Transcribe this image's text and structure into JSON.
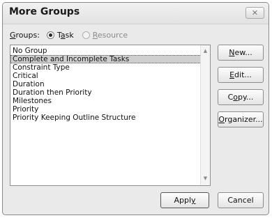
{
  "dialog": {
    "title": "More Groups",
    "close_glyph": "✕"
  },
  "groups": {
    "label_prefix": "G",
    "label_rest": "roups:",
    "options": [
      {
        "pre": "T",
        "u": "a",
        "post": "sk",
        "checked": true,
        "enabled": true
      },
      {
        "pre": "",
        "u": "R",
        "post": "esource",
        "checked": false,
        "enabled": false
      }
    ]
  },
  "list": {
    "items": [
      "No Group",
      "Complete and Incomplete Tasks",
      "Constraint Type",
      "Critical",
      "Duration",
      "Duration then Priority",
      "Milestones",
      "Priority",
      "Priority Keeping Outline Structure"
    ],
    "selected_index": 1
  },
  "buttons": {
    "new": {
      "u": "N",
      "rest": "ew..."
    },
    "edit": {
      "u": "E",
      "rest": "dit..."
    },
    "copy": {
      "pre": "C",
      "u": "o",
      "rest": "py..."
    },
    "organizer": {
      "u": "O",
      "rest": "rganizer..."
    },
    "apply": {
      "pre": "Appl",
      "u": "y",
      "rest": ""
    },
    "cancel": {
      "label": "Cancel"
    }
  },
  "icons": {
    "scroll_up": "▲",
    "scroll_down": "▼"
  }
}
